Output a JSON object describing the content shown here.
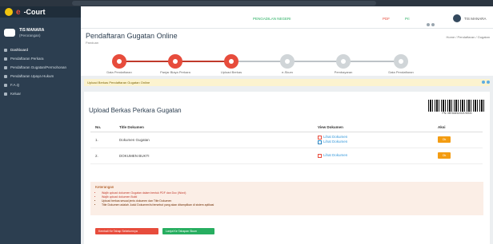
{
  "brand": {
    "e": "e",
    "rest": "-Court"
  },
  "profile": {
    "name": "TIS MANARA",
    "subtitle": "(Perorangan)"
  },
  "sidebar": {
    "items": [
      {
        "label": "Dashboard"
      },
      {
        "label": "Pendaftaran Perkara"
      },
      {
        "label": "Pendaftaran Gugatan/Permohonan"
      },
      {
        "label": "Pendaftaran Upaya Hukum"
      },
      {
        "label": "F.A.Q"
      },
      {
        "label": "Keluar"
      }
    ]
  },
  "topbar": {
    "notice": "PENGADILAN NEGERI",
    "pdf": "PDF",
    "pri": "Pri",
    "user": "TIS MANARA"
  },
  "page": {
    "title": "Pendaftaran Gugatan Online",
    "subtitle": "Panduan",
    "breadcrumb": "Home / Pendaftaran / Gugatan"
  },
  "stepper": {
    "steps": [
      {
        "label": "Data Pendaftaran",
        "done": true
      },
      {
        "label": "Panjar Biaya Perkara",
        "done": true
      },
      {
        "label": "Upload Berkas",
        "done": true
      },
      {
        "label": "e-Skum",
        "done": false
      },
      {
        "label": "Pembayaran",
        "done": false
      },
      {
        "label": "Data Pendaftaran",
        "done": false
      }
    ],
    "progress_done": 3
  },
  "alert": {
    "text": "Upload Berkas Pendaftaran Gugatan Online"
  },
  "card": {
    "title": "Upload Berkas Perkara Gugatan",
    "barcode_text": "PN. MEDAN/2021/0003"
  },
  "table": {
    "headers": {
      "no": "No.",
      "title": "Title Dokumen",
      "view": "View Dokumen",
      "action": "Aksi"
    },
    "rows": [
      {
        "no": "1.",
        "title": "Dokumen Gugatan",
        "links": [
          "Lihat Dokumen",
          "Lihat Dokumen"
        ],
        "action": "Ok"
      },
      {
        "no": "2.",
        "title": "DOKUMEN BUKTI",
        "links": [
          "Lihat Dokumen"
        ],
        "action": "Ok"
      }
    ]
  },
  "note": {
    "title": "Keterangan",
    "items": [
      {
        "text": "Wajib upload dokumen Gugatan dalam bentuk PDF dan Doc (Word)",
        "tone": "red"
      },
      {
        "text": "Wajib upload dokumen Bukti",
        "tone": "red"
      },
      {
        "text": "Upload berkas sesuai jenis dokumen dan Title Dokumen",
        "tone": "dark"
      },
      {
        "text": "Title Dokumen adalah Judul Dokumen/isi tersebut yang akan ditampilkan di sistem aplikasi",
        "tone": "dark"
      }
    ]
  },
  "buttons": {
    "back": "Kembali Ke Tahap Sebelumnya",
    "next": "Lanjut Ke Tahapan Skum"
  },
  "colors": {
    "accent_red": "#e74c3c",
    "sidebar_bg": "#2c3e50",
    "action_orange": "#f39c12",
    "success_green": "#27ae60"
  }
}
